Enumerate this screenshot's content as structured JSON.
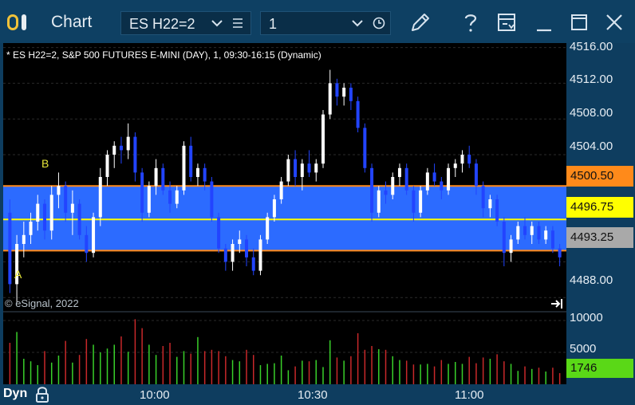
{
  "window": {
    "title": "Chart"
  },
  "toolbar": {
    "symbol": "ES H22=2",
    "interval": "1"
  },
  "chart": {
    "header": "* ES H22=2, S&P 500 FUTURES E-MINI (DAY), 1, 09:30-16:15 (Dynamic)",
    "copyright": "© eSignal, 2022",
    "markers": {
      "a": "A",
      "b": "B"
    }
  },
  "price_axis": {
    "ticks": [
      "4516.00",
      "4512.00",
      "4508.00",
      "4504.00",
      "4488.00"
    ],
    "badges": {
      "upper": "4500.50",
      "last": "4496.75",
      "lower": "4493.25"
    }
  },
  "volume_axis": {
    "ticks": [
      "10000",
      "5000"
    ],
    "last": "1746"
  },
  "time_axis": {
    "ticks": [
      "10:00",
      "10:30",
      "11:00"
    ]
  },
  "status_bar": {
    "mode": "Dyn"
  },
  "colors": {
    "band": "#2c6bff",
    "band_edge": "#ff8a1a",
    "last_line": "#ffff00",
    "up_candle": "#ffffff",
    "down_candle": "#2244ff",
    "vol_up": "#39d02a",
    "vol_down": "#c8282a"
  },
  "chart_data": {
    "type": "candlestick",
    "yrange": [
      4486.5,
      4516.5
    ],
    "volume_range": [
      0,
      11000
    ],
    "candles": [
      [
        4497.5,
        4499.0,
        4488.5,
        4489.5
      ],
      [
        4489.5,
        4495.0,
        4487.5,
        4494.0
      ],
      [
        4494.0,
        4496.5,
        4492.5,
        4495.0
      ],
      [
        4495.0,
        4497.5,
        4494.0,
        4496.5
      ],
      [
        4496.5,
        4499.5,
        4495.5,
        4498.5
      ],
      [
        4498.5,
        4499.0,
        4494.5,
        4495.5
      ],
      [
        4495.5,
        4500.5,
        4494.5,
        4499.5
      ],
      [
        4499.5,
        4502.0,
        4498.0,
        4500.5
      ],
      [
        4500.5,
        4501.0,
        4496.5,
        4497.5
      ],
      [
        4497.5,
        4500.0,
        4495.0,
        4498.5
      ],
      [
        4498.5,
        4499.0,
        4494.5,
        4495.0
      ],
      [
        4495.0,
        4496.0,
        4492.0,
        4493.0
      ],
      [
        4493.0,
        4497.5,
        4492.5,
        4497.0
      ],
      [
        4497.0,
        4502.5,
        4496.0,
        4501.5
      ],
      [
        4501.5,
        4504.5,
        4500.5,
        4504.0
      ],
      [
        4504.0,
        4505.5,
        4502.5,
        4505.0
      ],
      [
        4505.0,
        4506.0,
        4503.0,
        4504.5
      ],
      [
        4504.5,
        4507.5,
        4503.5,
        4506.0
      ],
      [
        4506.0,
        4506.5,
        4501.0,
        4502.0
      ],
      [
        4502.0,
        4502.5,
        4496.5,
        4497.5
      ],
      [
        4497.5,
        4501.0,
        4497.0,
        4500.5
      ],
      [
        4500.5,
        4503.5,
        4499.5,
        4502.5
      ],
      [
        4502.5,
        4503.0,
        4499.5,
        4500.0
      ],
      [
        4500.0,
        4501.0,
        4497.5,
        4498.5
      ],
      [
        4498.5,
        4500.5,
        4498.0,
        4500.0
      ],
      [
        4500.0,
        4505.5,
        4499.5,
        4505.0
      ],
      [
        4505.0,
        4506.0,
        4501.0,
        4501.5
      ],
      [
        4501.5,
        4503.0,
        4500.5,
        4502.5
      ],
      [
        4502.5,
        4503.0,
        4500.0,
        4501.0
      ],
      [
        4501.0,
        4501.5,
        4496.5,
        4497.0
      ],
      [
        4497.0,
        4497.5,
        4493.0,
        4493.5
      ],
      [
        4493.5,
        4494.0,
        4491.0,
        4492.0
      ],
      [
        4492.0,
        4494.5,
        4491.0,
        4494.0
      ],
      [
        4494.0,
        4495.5,
        4493.0,
        4494.5
      ],
      [
        4494.5,
        4495.0,
        4491.5,
        4492.5
      ],
      [
        4492.5,
        4493.5,
        4490.5,
        4491.0
      ],
      [
        4491.0,
        4495.0,
        4490.5,
        4494.5
      ],
      [
        4494.5,
        4497.5,
        4494.0,
        4497.0
      ],
      [
        4497.0,
        4499.5,
        4496.5,
        4499.0
      ],
      [
        4499.0,
        4501.5,
        4498.5,
        4501.0
      ],
      [
        4501.0,
        4504.0,
        4500.5,
        4503.5
      ],
      [
        4503.5,
        4504.5,
        4500.5,
        4501.5
      ],
      [
        4501.5,
        4503.5,
        4500.0,
        4503.0
      ],
      [
        4503.0,
        4504.5,
        4501.5,
        4502.0
      ],
      [
        4502.0,
        4503.5,
        4501.0,
        4503.0
      ],
      [
        4503.0,
        4509.0,
        4502.5,
        4508.5
      ],
      [
        4508.5,
        4513.5,
        4508.0,
        4512.0
      ],
      [
        4512.0,
        4512.5,
        4509.5,
        4510.5
      ],
      [
        4510.5,
        4512.0,
        4509.5,
        4511.5
      ],
      [
        4511.5,
        4512.0,
        4509.0,
        4510.0
      ],
      [
        4510.0,
        4510.5,
        4506.5,
        4507.0
      ],
      [
        4507.0,
        4507.5,
        4502.0,
        4502.5
      ],
      [
        4502.5,
        4503.0,
        4496.5,
        4497.5
      ],
      [
        4497.5,
        4500.5,
        4497.0,
        4500.0
      ],
      [
        4500.0,
        4501.0,
        4498.5,
        4499.5
      ],
      [
        4499.5,
        4502.0,
        4499.0,
        4501.5
      ],
      [
        4501.5,
        4503.0,
        4500.5,
        4502.5
      ],
      [
        4502.5,
        4503.0,
        4499.5,
        4500.0
      ],
      [
        4500.0,
        4500.5,
        4496.5,
        4497.5
      ],
      [
        4497.5,
        4500.5,
        4497.0,
        4500.0
      ],
      [
        4500.0,
        4502.5,
        4499.5,
        4502.0
      ],
      [
        4502.0,
        4503.0,
        4500.5,
        4501.0
      ],
      [
        4501.0,
        4501.5,
        4499.0,
        4500.0
      ],
      [
        4500.0,
        4503.0,
        4499.5,
        4502.5
      ],
      [
        4502.5,
        4503.5,
        4501.5,
        4503.0
      ],
      [
        4503.0,
        4504.5,
        4502.0,
        4504.0
      ],
      [
        4504.0,
        4505.0,
        4502.5,
        4503.0
      ],
      [
        4503.0,
        4503.5,
        4499.5,
        4500.5
      ],
      [
        4500.5,
        4501.0,
        4497.0,
        4498.0
      ],
      [
        4498.0,
        4499.5,
        4497.0,
        4499.0
      ],
      [
        4499.0,
        4499.5,
        4496.0,
        4496.5
      ],
      [
        4496.5,
        4497.0,
        4491.5,
        4493.0
      ],
      [
        4493.0,
        4495.0,
        4492.0,
        4494.5
      ],
      [
        4494.5,
        4496.5,
        4494.0,
        4496.0
      ],
      [
        4496.0,
        4497.0,
        4494.5,
        4495.0
      ],
      [
        4495.0,
        4496.5,
        4494.0,
        4496.0
      ],
      [
        4496.0,
        4496.5,
        4494.0,
        4494.5
      ],
      [
        4494.5,
        4496.0,
        4494.0,
        4495.5
      ],
      [
        4495.5,
        4496.0,
        4493.0,
        4493.5
      ],
      [
        4493.5,
        4494.0,
        4491.5,
        4492.5
      ]
    ],
    "volumes": [
      6500,
      8200,
      4000,
      3600,
      3000,
      5200,
      3400,
      4500,
      6800,
      3400,
      4600,
      7100,
      6200,
      5000,
      5600,
      6200,
      7500,
      5100,
      10200,
      8800,
      6200,
      4600,
      6000,
      6500,
      4300,
      5200,
      4800,
      7400,
      5200,
      5400,
      5200,
      4400,
      3800,
      3600,
      5400,
      4600,
      3000,
      3200,
      3300,
      4500,
      2200,
      2800,
      3700,
      3600,
      3800,
      2700,
      6900,
      4200,
      3700,
      4400,
      8000,
      5400,
      6000,
      5500,
      5400,
      4400,
      3800,
      3700,
      3100,
      3100,
      3200,
      2800,
      3800,
      3200,
      3500,
      3200,
      4300,
      3300,
      4200,
      4000,
      4700,
      3600,
      3200,
      2100,
      2800,
      2400,
      2600,
      2000,
      2600,
      1746
    ]
  }
}
